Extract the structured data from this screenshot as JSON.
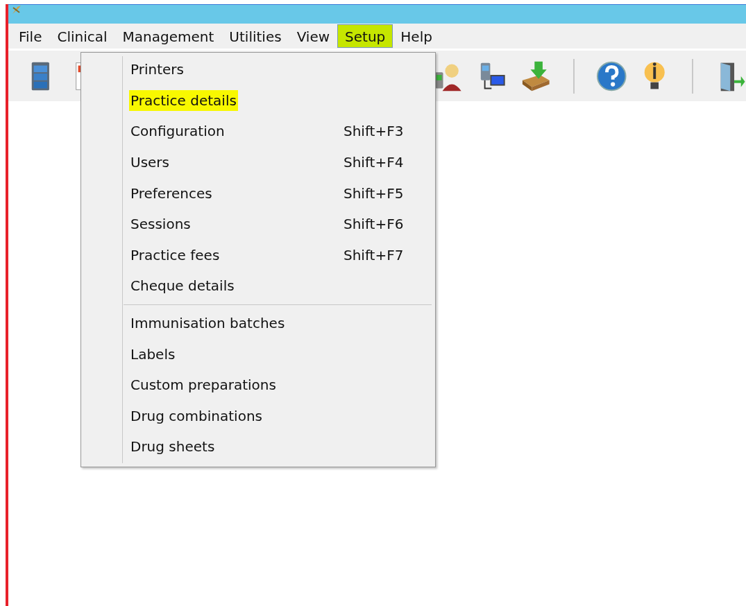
{
  "menu_bar": [
    {
      "label": "File",
      "selected": false
    },
    {
      "label": "Clinical",
      "selected": false
    },
    {
      "label": "Management",
      "selected": false
    },
    {
      "label": "Utilities",
      "selected": false
    },
    {
      "label": "View",
      "selected": false
    },
    {
      "label": "Setup",
      "selected": true
    },
    {
      "label": "Help",
      "selected": false
    }
  ],
  "dropdown": {
    "groups": [
      [
        {
          "label": "Printers",
          "highlighted": false
        },
        {
          "label": "Practice details",
          "highlighted": true
        },
        {
          "label": "Configuration",
          "shortcut": "Shift+F3",
          "highlighted": false
        },
        {
          "label": "Users",
          "shortcut": "Shift+F4",
          "highlighted": false
        },
        {
          "label": "Preferences",
          "shortcut": "Shift+F5",
          "highlighted": false
        },
        {
          "label": "Sessions",
          "shortcut": "Shift+F6",
          "highlighted": false
        },
        {
          "label": "Practice fees",
          "shortcut": "Shift+F7",
          "highlighted": false
        },
        {
          "label": "Cheque details",
          "highlighted": false
        }
      ],
      [
        {
          "label": "Immunisation batches",
          "highlighted": false
        },
        {
          "label": "Labels",
          "highlighted": false
        },
        {
          "label": "Custom preparations",
          "highlighted": false
        },
        {
          "label": "Drug combinations",
          "highlighted": false
        },
        {
          "label": "Drug sheets",
          "highlighted": false
        }
      ]
    ]
  }
}
